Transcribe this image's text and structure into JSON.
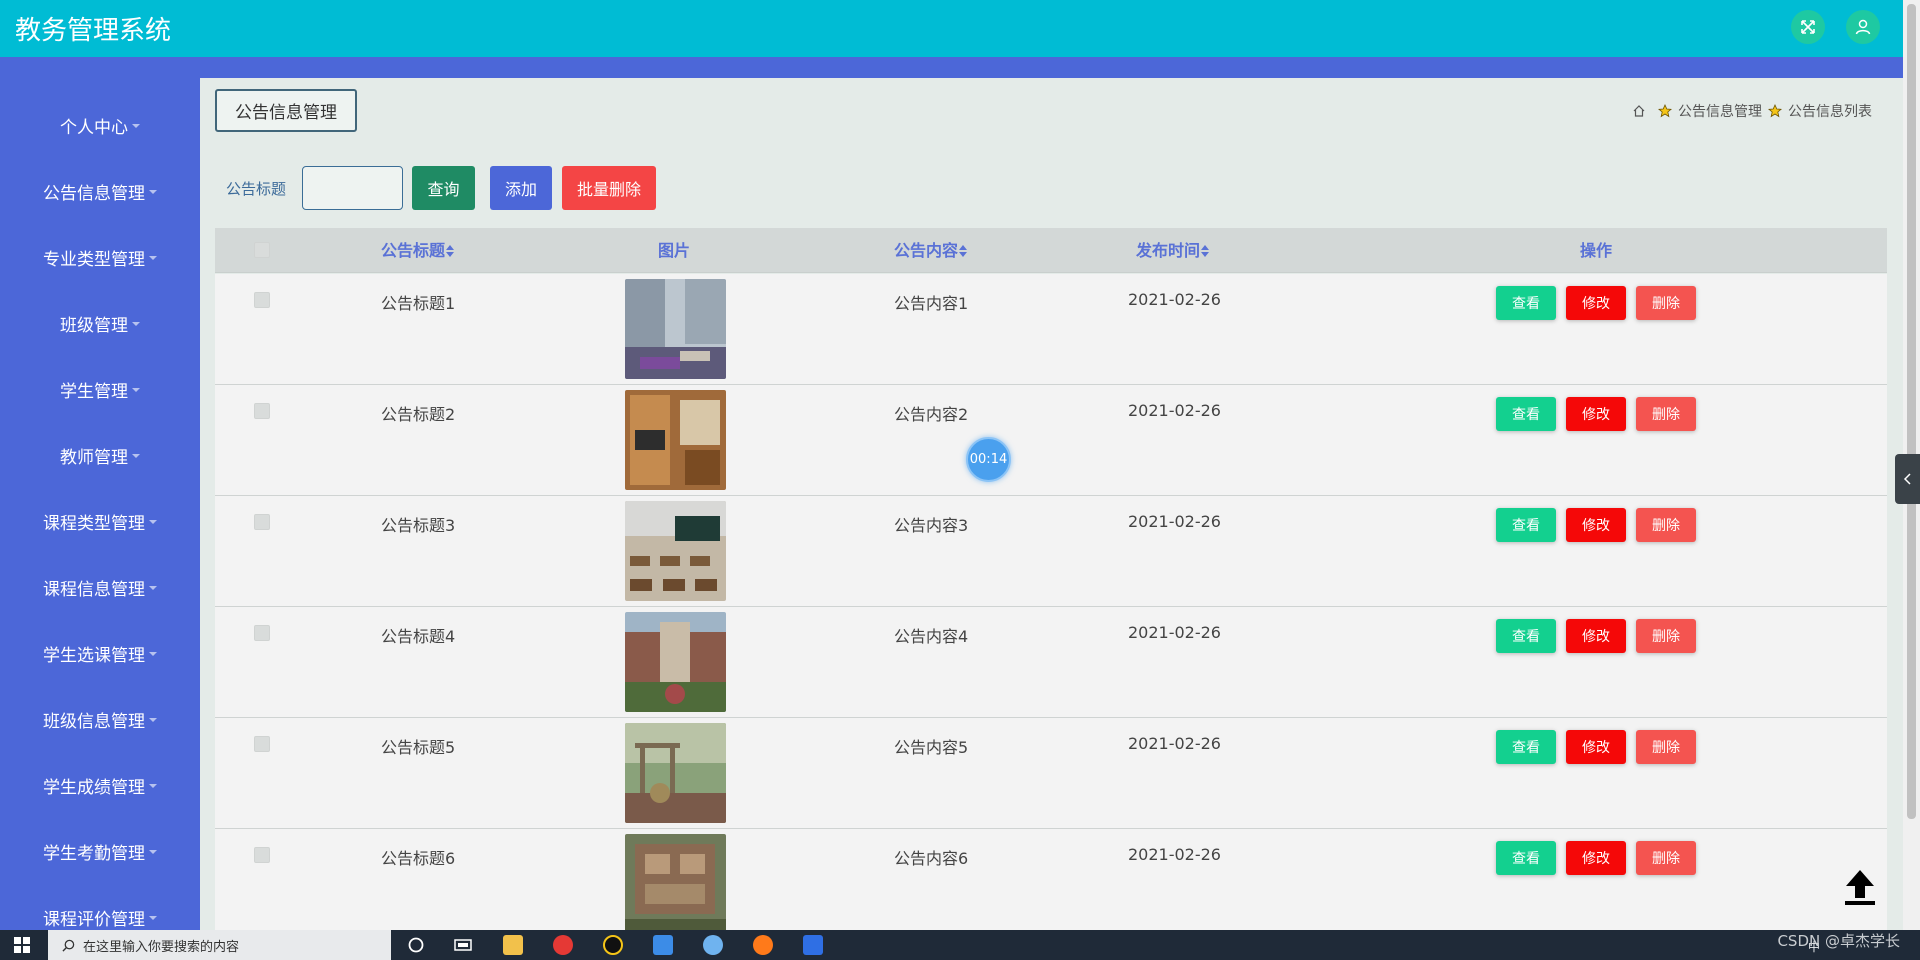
{
  "app": {
    "title": "教务管理系统"
  },
  "sidebar": {
    "items": [
      {
        "label": "个人中心"
      },
      {
        "label": "公告信息管理"
      },
      {
        "label": "专业类型管理"
      },
      {
        "label": "班级管理"
      },
      {
        "label": "学生管理"
      },
      {
        "label": "教师管理"
      },
      {
        "label": "课程类型管理"
      },
      {
        "label": "课程信息管理"
      },
      {
        "label": "学生选课管理"
      },
      {
        "label": "班级信息管理"
      },
      {
        "label": "学生成绩管理"
      },
      {
        "label": "学生考勤管理"
      },
      {
        "label": "课程评价管理"
      }
    ]
  },
  "page": {
    "section_title": "公告信息管理",
    "breadcrumb": [
      "公告信息管理",
      "公告信息列表"
    ]
  },
  "search": {
    "label": "公告标题",
    "value": "",
    "query_label": "查询",
    "add_label": "添加",
    "batch_delete_label": "批量删除"
  },
  "table": {
    "columns": [
      "公告标题",
      "图片",
      "公告内容",
      "发布时间",
      "操作"
    ],
    "rows": [
      {
        "title": "公告标题1",
        "content": "公告内容1",
        "date": "2021-02-26",
        "image": "campus-atrium-photo"
      },
      {
        "title": "公告标题2",
        "content": "公告内容2",
        "date": "2021-02-26",
        "image": "dorm-room-photo"
      },
      {
        "title": "公告标题3",
        "content": "公告内容3",
        "date": "2021-02-26",
        "image": "classroom-photo"
      },
      {
        "title": "公告标题4",
        "content": "公告内容4",
        "date": "2021-02-26",
        "image": "school-building-photo"
      },
      {
        "title": "公告标题5",
        "content": "公告内容5",
        "date": "2021-02-26",
        "image": "campus-sculpture-photo"
      },
      {
        "title": "公告标题6",
        "content": "公告内容6",
        "date": "2021-02-26",
        "image": "campus-aerial-photo"
      }
    ],
    "actions": {
      "view": "查看",
      "edit": "修改",
      "delete": "删除"
    }
  },
  "overlay": {
    "timer": "00:14"
  },
  "taskbar": {
    "search_placeholder": "在这里输入你要搜索的内容",
    "tray_text": "中",
    "watermark": "CSDN @卓杰学长"
  },
  "colors": {
    "header": "#00bcd4",
    "sidebar": "#4c67d8",
    "view": "#13d08f",
    "edit": "#f50808",
    "delete": "#f45450"
  }
}
